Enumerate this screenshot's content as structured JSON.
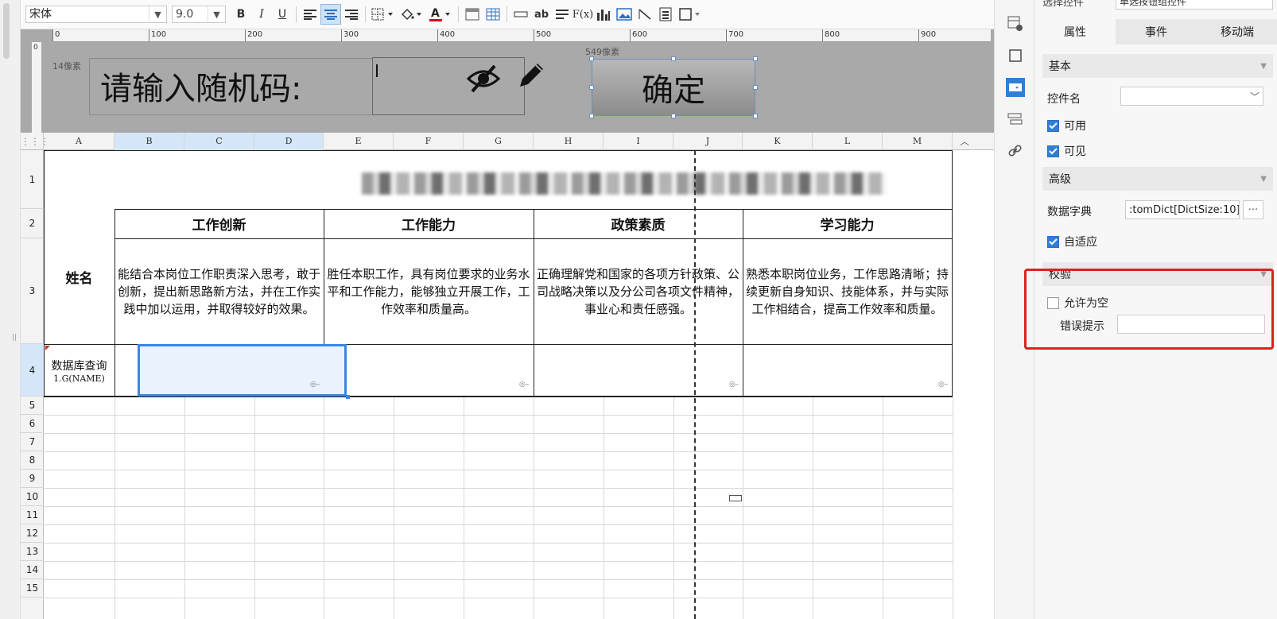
{
  "toolbar": {
    "font_name": "宋体",
    "font_size": "9.0",
    "bold": "B",
    "italic": "I",
    "underline": "U",
    "strike_text": "ab",
    "formula_text": "F(x)",
    "font_color_text": "A"
  },
  "ruler": {
    "ticks": [
      "0",
      "100",
      "200",
      "300",
      "400",
      "500",
      "600",
      "700",
      "800",
      "900"
    ],
    "vertical_zero": "0"
  },
  "design": {
    "label_margin_text": "14像素",
    "label_text": "请输入随机码:",
    "button_margin_text": "549像素",
    "confirm_button_label": "确定"
  },
  "sheet": {
    "columns": [
      "A",
      "B",
      "C",
      "D",
      "E",
      "F",
      "G",
      "H",
      "I",
      "J",
      "K",
      "L",
      "M"
    ],
    "rows": [
      "1",
      "2",
      "3",
      "4",
      "5",
      "6",
      "7",
      "8",
      "9",
      "10",
      "11",
      "12",
      "13",
      "14",
      "15"
    ],
    "name_header": "姓名",
    "category_headers": [
      "工作创新",
      "工作能力",
      "政策素质",
      "学习能力"
    ],
    "descriptions": [
      "能结合本岗位工作职责深入思考，敢于创新，提出新思路新方法，并在工作实践中加以运用，并取得较好的效果。",
      "胜任本职工作，具有岗位要求的业务水平和工作能力，能够独立开展工作，工作效率和质量高。",
      "正确理解党和国家的各项方针政策、公司战略决策以及分公司各项文件精神，事业心和责任感强。",
      "熟悉本职岗位业务，工作思路清晰；持续更新自身知识、技能体系，并与实际工作相结合，提高工作效率和质量。"
    ],
    "data_cell_line1": "数据库查询",
    "data_cell_line2": "1.G(NAME)"
  },
  "panel": {
    "top_label": "选择控件",
    "top_value": "单选按钮组控件",
    "tabs": [
      "属性",
      "事件",
      "移动端"
    ],
    "basic_section": "基本",
    "control_name_label": "控件名",
    "control_name_value": "",
    "enabled_label": "可用",
    "visible_label": "可见",
    "advanced_section": "高级",
    "dictionary_label": "数据字典",
    "dictionary_value": ":tomDict[DictSize:10]",
    "dictionary_more": "···",
    "autofit_label": "自适应",
    "validation_section": "校验",
    "allow_empty_label": "允许为空",
    "error_tip_label": "错误提示",
    "error_tip_value": ""
  }
}
